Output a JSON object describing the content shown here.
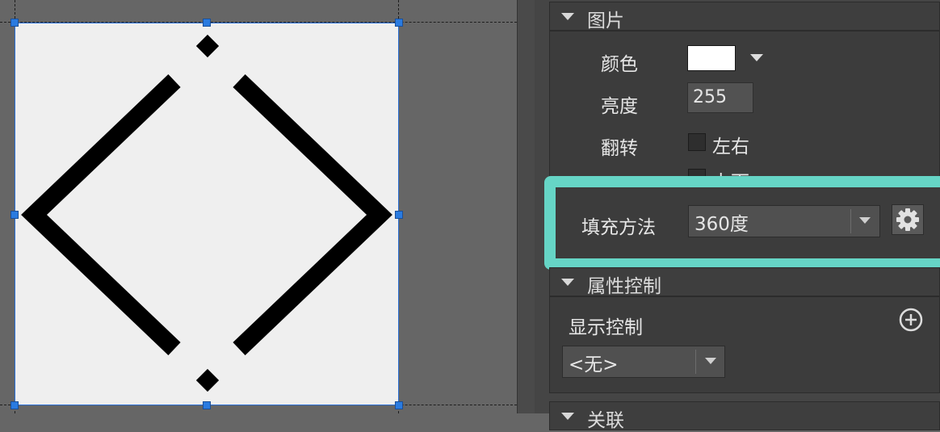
{
  "canvas": {
    "selection_color": "#2a7be0",
    "artwork_background": "#efefef",
    "artwork_foreground": "#000000"
  },
  "panel": {
    "image_section": {
      "title": "图片",
      "color_label": "颜色",
      "color_value": "#ffffff",
      "brightness_label": "亮度",
      "brightness_value": "255",
      "flip_label": "翻转",
      "flip_horizontal_label": "左右",
      "flip_vertical_label": "上下"
    },
    "fill": {
      "label": "填充方法",
      "value": "360度",
      "highlight_color": "#66d5c6"
    },
    "attribute_section": {
      "title": "属性控制",
      "display_control_label": "显示控制",
      "display_control_value": "<无>"
    },
    "next_section": {
      "title": "关联"
    }
  }
}
